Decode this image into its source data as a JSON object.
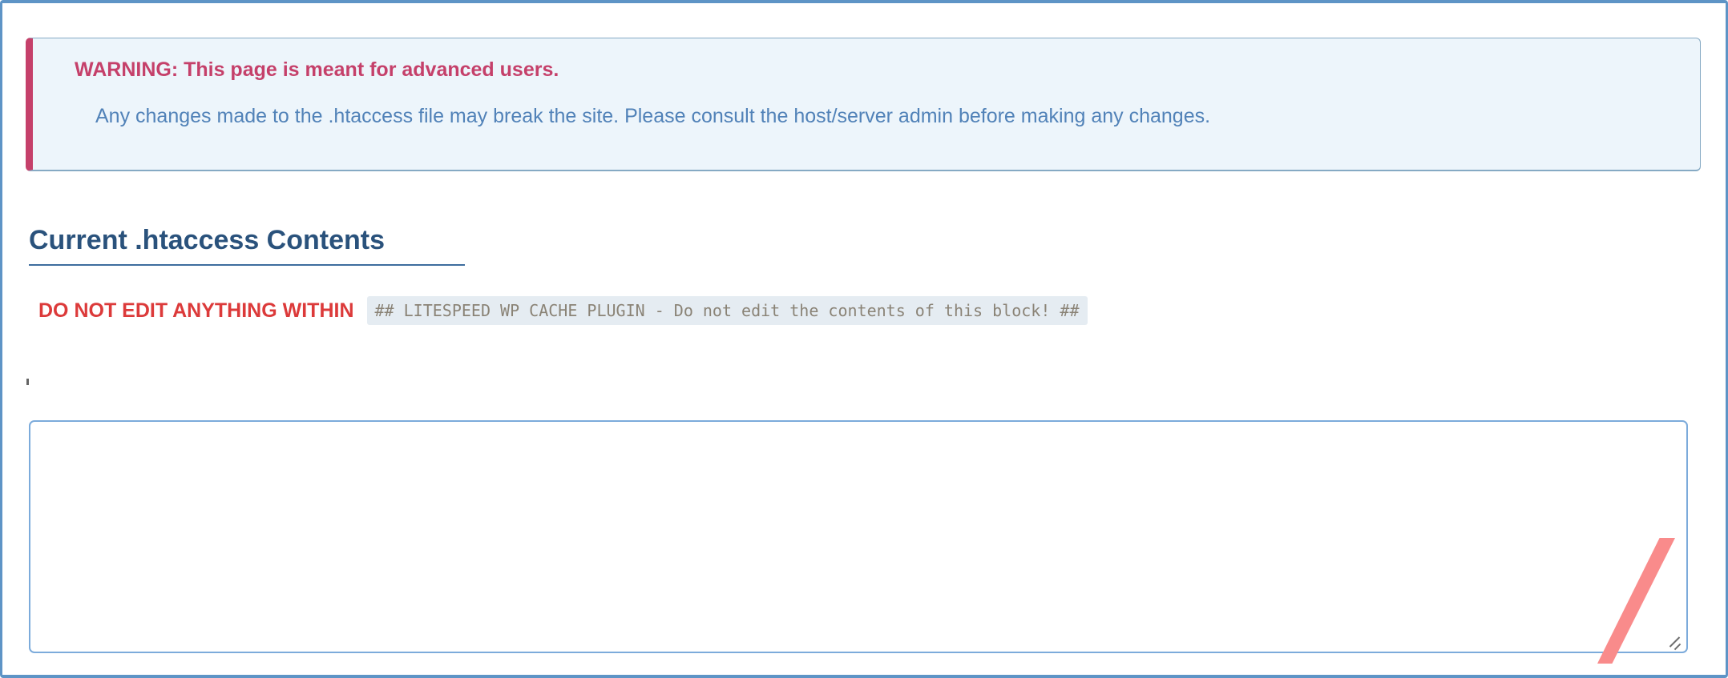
{
  "warning": {
    "title": "WARNING: This page is meant for advanced users.",
    "body": "Any changes made to the .htaccess file may break the site. Please consult the host/server admin before making any changes."
  },
  "section": {
    "heading": "Current .htaccess Contents"
  },
  "notice": {
    "label": "DO NOT EDIT ANYTHING WITHIN",
    "code": "## LITESPEED WP CACHE PLUGIN - Do not edit the contents of this block! ##"
  },
  "editor": {
    "value": ""
  },
  "colors": {
    "frame": "#5e94c6",
    "warning_bg": "#edf5fb",
    "warning_border": "#86aac4",
    "warning_accent": "#c5406a",
    "warning_title": "#c5406a",
    "warning_body": "#5182b8",
    "heading": "#2a527c",
    "heading_underline": "#3d6d9e",
    "notice_label": "#dc3a3a",
    "code_text": "#8a8376",
    "code_bg": "#e5ecf2",
    "textarea_border": "#7cabdb",
    "stripe": "#f98b8b",
    "grippie": "#6e6e6e"
  }
}
